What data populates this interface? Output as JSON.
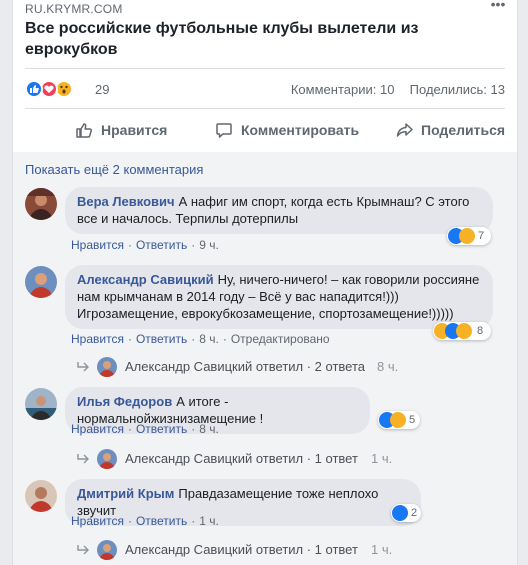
{
  "post": {
    "source": "RU.KRYMR.COM",
    "title": "Все российские футбольные клубы вылетели из еврокубков",
    "reaction_count": "29",
    "comments_count": "Комментарии: 10",
    "shares_count": "Поделились: 13"
  },
  "actions": {
    "like": "Нравится",
    "comment": "Комментировать",
    "share": "Поделиться"
  },
  "show_more": "Показать ещё 2 комментария",
  "meta_labels": {
    "like": "Нравится",
    "reply": "Ответить",
    "edited": "Отредактировано"
  },
  "comments": [
    {
      "author": "Вера Левкович",
      "text": "А нафиг им спорт, когда есть Крымнаш? С этого все и началось. Терпилы дотерпилы",
      "time": "9 ч.",
      "reactions": "7"
    },
    {
      "author": "Александр Савицкий",
      "text": "Ну, ничего-ничего! – как говорили россияне нам крымчанам в 2014 году – Всё у вас нападится!))) Игрозамещение, еврокубкозамещение, спортозамещение!)))))",
      "time": "8 ч.",
      "reactions": "8",
      "replies": "Александр Савицкий ответил · 2 ответа",
      "replies_time": "8 ч."
    },
    {
      "author": "Илья Федоров",
      "text": "А итоге - нормальнойжизнизамещение !",
      "time": "8 ч.",
      "reactions": "5",
      "replies": "Александр Савицкий ответил · 1 ответ",
      "replies_time": "1 ч."
    },
    {
      "author": "Дмитрий Крым",
      "text": "Правдазамещение тоже неплохо звучит",
      "time": "1 ч.",
      "reactions": "2",
      "replies": "Александр Савицкий ответил · 1 ответ",
      "replies_time": "1 ч."
    }
  ],
  "colors": {
    "link": "#385898",
    "like_blue": "#1877f2",
    "love_red": "#f33e58",
    "haha_yellow": "#f7b125"
  }
}
